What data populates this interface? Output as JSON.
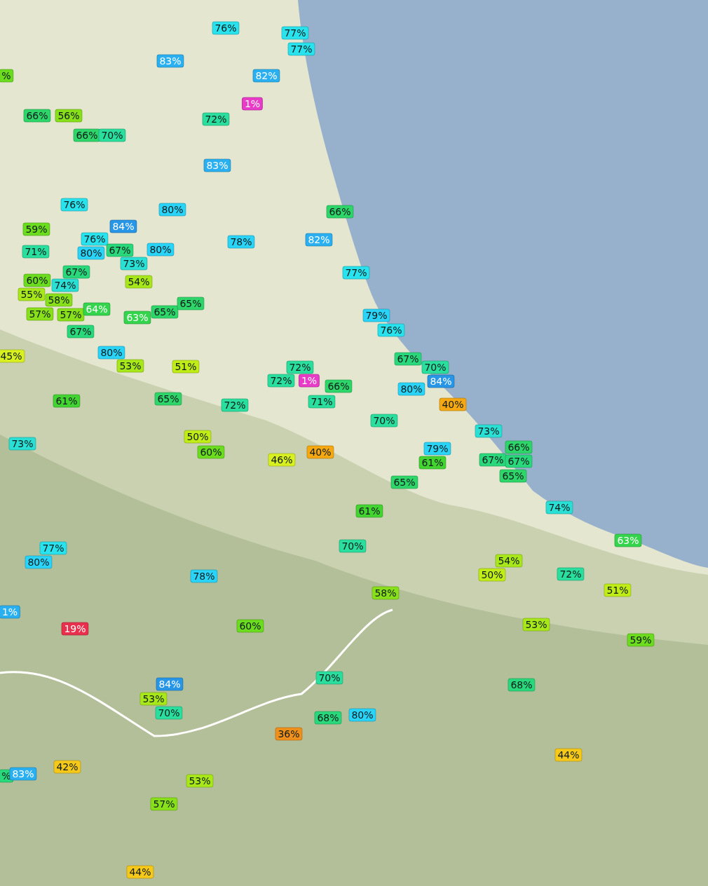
{
  "map": {
    "badges": [
      {
        "text": "76%",
        "color": "#28e2ee"
      },
      {
        "text": "77%",
        "color": "#28e2ee"
      },
      {
        "text": "77%",
        "color": "#28e2ee"
      },
      {
        "text": "83%",
        "color": "#2ab0f0"
      },
      {
        "text": "%",
        "color": "#6cdc1e"
      },
      {
        "text": "82%",
        "color": "#2ab0f0"
      },
      {
        "text": "1%",
        "color": "#e83cc8"
      },
      {
        "text": "66%",
        "color": "#2ed66a"
      },
      {
        "text": "56%",
        "color": "#88e01a"
      },
      {
        "text": "72%",
        "color": "#2ade9e"
      },
      {
        "text": "66%",
        "color": "#2ed66a"
      },
      {
        "text": "70%",
        "color": "#2ade9e"
      },
      {
        "text": "83%",
        "color": "#2ab0f0"
      },
      {
        "text": "76%",
        "color": "#28e2ee"
      },
      {
        "text": "80%",
        "color": "#2ad4f8"
      },
      {
        "text": "66%",
        "color": "#2ed66a"
      },
      {
        "text": "59%",
        "color": "#6cdc1e"
      },
      {
        "text": "84%",
        "color": "#2896e6"
      },
      {
        "text": "76%",
        "color": "#28e2ee"
      },
      {
        "text": "78%",
        "color": "#2ad4f8"
      },
      {
        "text": "82%",
        "color": "#2ab0f0"
      },
      {
        "text": "71%",
        "color": "#2ade9e"
      },
      {
        "text": "80%",
        "color": "#2ad4f8"
      },
      {
        "text": "67%",
        "color": "#2ad87c"
      },
      {
        "text": "80%",
        "color": "#2ad4f8"
      },
      {
        "text": "73%",
        "color": "#2ae0d4"
      },
      {
        "text": "67%",
        "color": "#2ad87c"
      },
      {
        "text": "77%",
        "color": "#28e2ee"
      },
      {
        "text": "60%",
        "color": "#6cdc1e"
      },
      {
        "text": "74%",
        "color": "#2ae0d4"
      },
      {
        "text": "54%",
        "color": "#a8e81a"
      },
      {
        "text": "55%",
        "color": "#a8e81a"
      },
      {
        "text": "58%",
        "color": "#88e01a"
      },
      {
        "text": "57%",
        "color": "#88e01a"
      },
      {
        "text": "57%",
        "color": "#88e01a"
      },
      {
        "text": "64%",
        "color": "#34d44c"
      },
      {
        "text": "63%",
        "color": "#34d44c"
      },
      {
        "text": "65%",
        "color": "#2ed66a"
      },
      {
        "text": "65%",
        "color": "#2ed66a"
      },
      {
        "text": "79%",
        "color": "#2ad4f8"
      },
      {
        "text": "67%",
        "color": "#2ad87c"
      },
      {
        "text": "76%",
        "color": "#28e2ee"
      },
      {
        "text": "45%",
        "color": "#d8f020"
      },
      {
        "text": "80%",
        "color": "#2ad4f8"
      },
      {
        "text": "53%",
        "color": "#a8e81a"
      },
      {
        "text": "51%",
        "color": "#c0ec18"
      },
      {
        "text": "72%",
        "color": "#2ade9e"
      },
      {
        "text": "67%",
        "color": "#2ad87c"
      },
      {
        "text": "70%",
        "color": "#2ade9e"
      },
      {
        "text": "72%",
        "color": "#2ade9e"
      },
      {
        "text": "1%",
        "color": "#e83cc8"
      },
      {
        "text": "66%",
        "color": "#2ed66a"
      },
      {
        "text": "80%",
        "color": "#2ad4f8"
      },
      {
        "text": "84%",
        "color": "#2896e6"
      },
      {
        "text": "61%",
        "color": "#44d432"
      },
      {
        "text": "65%",
        "color": "#2ed66a"
      },
      {
        "text": "72%",
        "color": "#2ade9e"
      },
      {
        "text": "71%",
        "color": "#2ade9e"
      },
      {
        "text": "40%",
        "color": "#f5a812"
      },
      {
        "text": "70%",
        "color": "#2ade9e"
      },
      {
        "text": "50%",
        "color": "#c0ec18"
      },
      {
        "text": "73%",
        "color": "#2ae0d4"
      },
      {
        "text": "73%",
        "color": "#2ae0d4"
      },
      {
        "text": "60%",
        "color": "#6cdc1e"
      },
      {
        "text": "40%",
        "color": "#f5a812"
      },
      {
        "text": "79%",
        "color": "#2ad4f8"
      },
      {
        "text": "66%",
        "color": "#2ed66a"
      },
      {
        "text": "46%",
        "color": "#d8f020"
      },
      {
        "text": "61%",
        "color": "#44d432"
      },
      {
        "text": "67%",
        "color": "#2ad87c"
      },
      {
        "text": "67%",
        "color": "#2ad87c"
      },
      {
        "text": "65%",
        "color": "#2ed66a"
      },
      {
        "text": "65%",
        "color": "#2ed66a"
      },
      {
        "text": "61%",
        "color": "#44d432"
      },
      {
        "text": "74%",
        "color": "#2ae0d4"
      },
      {
        "text": "77%",
        "color": "#28e2ee"
      },
      {
        "text": "70%",
        "color": "#2ade9e"
      },
      {
        "text": "63%",
        "color": "#34d44c"
      },
      {
        "text": "80%",
        "color": "#2ad4f8"
      },
      {
        "text": "54%",
        "color": "#a8e81a"
      },
      {
        "text": "78%",
        "color": "#2ad4f8"
      },
      {
        "text": "50%",
        "color": "#c0ec18"
      },
      {
        "text": "72%",
        "color": "#2ade9e"
      },
      {
        "text": "58%",
        "color": "#88e01a"
      },
      {
        "text": "51%",
        "color": "#c0ec18"
      },
      {
        "text": "1%",
        "color": "#2ab0f0"
      },
      {
        "text": "19%",
        "color": "#e8304c"
      },
      {
        "text": "60%",
        "color": "#6cdc1e"
      },
      {
        "text": "53%",
        "color": "#a8e81a"
      },
      {
        "text": "59%",
        "color": "#6cdc1e"
      },
      {
        "text": "84%",
        "color": "#2896e6"
      },
      {
        "text": "70%",
        "color": "#2ade9e"
      },
      {
        "text": "68%",
        "color": "#2ad87c"
      },
      {
        "text": "53%",
        "color": "#a8e81a"
      },
      {
        "text": "70%",
        "color": "#2ade9e"
      },
      {
        "text": "68%",
        "color": "#2ad87c"
      },
      {
        "text": "80%",
        "color": "#2ad4f8"
      },
      {
        "text": "36%",
        "color": "#f0901c"
      },
      {
        "text": "44%",
        "color": "#f5c81a"
      },
      {
        "text": "%",
        "color": "#2ad87c"
      },
      {
        "text": "83%",
        "color": "#2ab0f0"
      },
      {
        "text": "42%",
        "color": "#f5c81a"
      },
      {
        "text": "53%",
        "color": "#a8e81a"
      },
      {
        "text": "57%",
        "color": "#88e01a"
      },
      {
        "text": "44%",
        "color": "#f5c81a"
      }
    ]
  }
}
